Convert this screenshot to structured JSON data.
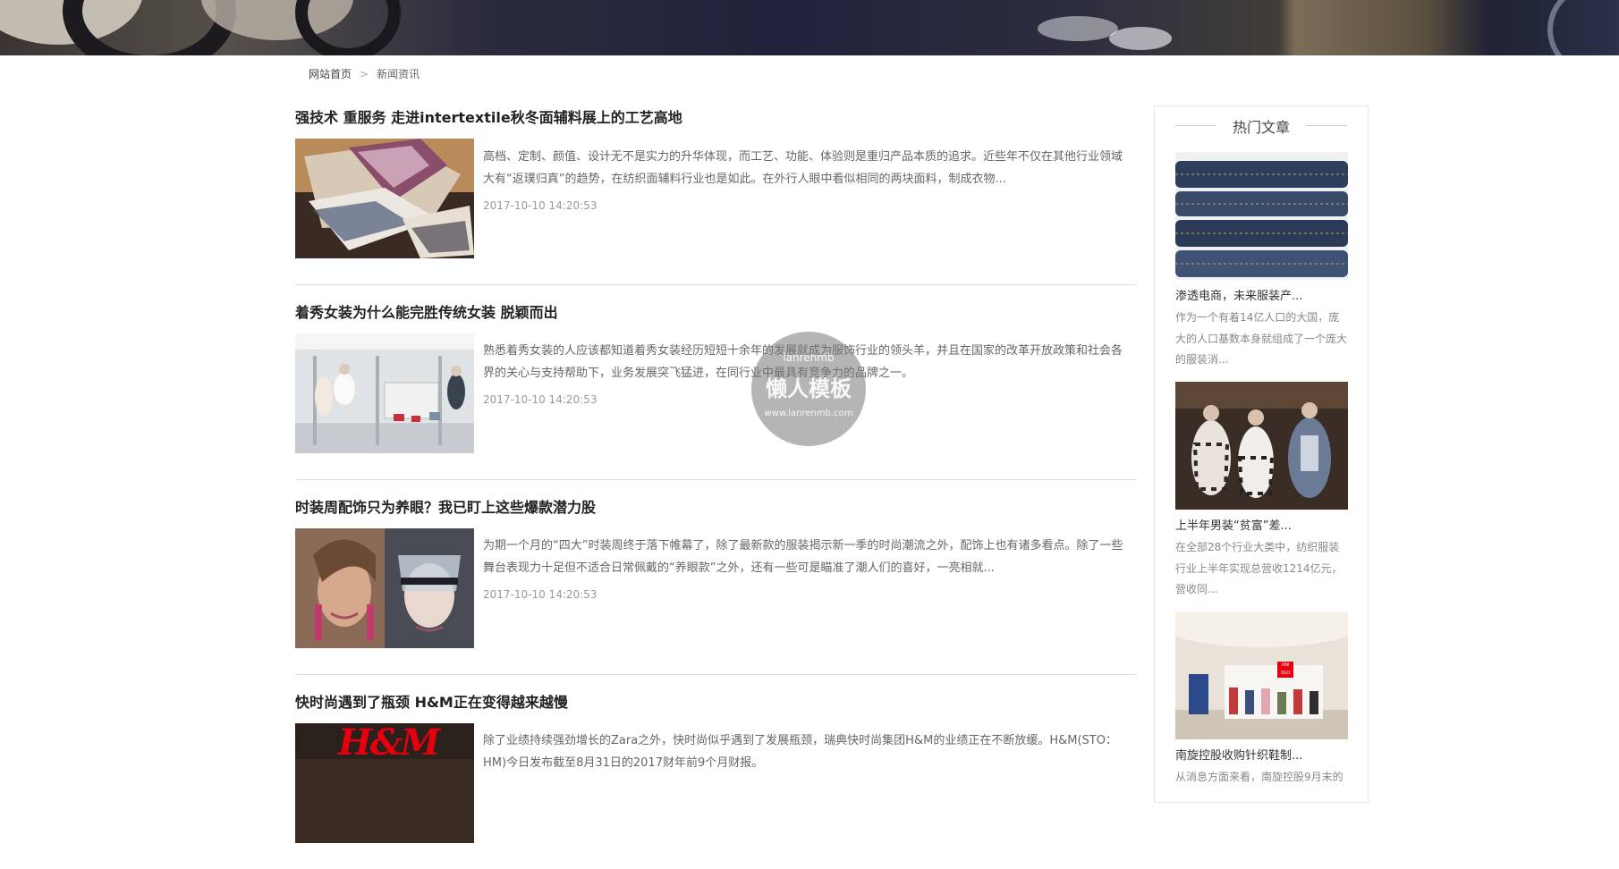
{
  "breadcrumb": {
    "home": "网站首页",
    "separator": ">",
    "current": "新闻资讯"
  },
  "articles": [
    {
      "title": "强技术 重服务 走进intertextile秋冬面辅料展上的工艺高地",
      "summary": "高档、定制、颜值、设计无不是实力的升华体现，而工艺、功能、体验则是重归产品本质的追求。近些年不仅在其他行业领域大有“返璞归真”的趋势，在纺织面辅料行业也是如此。在外行人眼中看似相同的两块面料，制成衣物...",
      "date": "2017-10-10 14:20:53",
      "image": "folded-textile-fabrics-photo"
    },
    {
      "title": "着秀女装为什么能完胜传统女装 脱颖而出",
      "summary": "熟悉着秀女装的人应该都知道着秀女装经历短短十余年的发展就成为服饰行业的领头羊，并且在国家的改革开放政策和社会各界的关心与支持帮助下，业务发展突飞猛进，在同行业中最具有竞争力的品牌之一。",
      "date": "2017-10-10 14:20:53",
      "image": "clothing-store-interior-photo"
    },
    {
      "title": "时装周配饰只为养眼？我已盯上这些爆款潜力股",
      "summary": "为期一个月的“四大”时装周终于落下帷幕了，除了最新款的服装揭示新一季的时尚潮流之外，配饰上也有诸多看点。除了一些舞台表现力十足但不适合日常佩戴的“养眼款”之外，还有一些可是瞄准了潮人们的喜好，一亮相就...",
      "date": "2017-10-10 14:20:53",
      "image": "fashion-models-accessories-photo"
    },
    {
      "title": "快时尚遇到了瓶颈 H&M正在变得越来越慢",
      "summary": "除了业绩持续强劲增长的Zara之外，快时尚似乎遇到了发展瓶颈，瑞典快时尚集团H&M的业绩正在不断放缓。H&M(STO：HM)今日发布截至8月31日的2017财年前9个月财报。",
      "date": "",
      "image": "hm-store-sign-photo",
      "logo_text": "H&M"
    }
  ],
  "sidebar": {
    "heading": "热门文章",
    "items": [
      {
        "title": "渗透电商，未来服装产...",
        "desc": "作为一个有着14亿人口的大国，庞大的人口基数本身就组成了一个庞大的服装消...",
        "image": "stacked-jeans-photo"
      },
      {
        "title": "上半年男装“贫富”差...",
        "desc": "在全部28个行业大类中，纺织服装行业上半年实现总营收1214亿元，营收同...",
        "image": "mannequins-store-photo"
      },
      {
        "title": "南旋控股收购针织鞋制...",
        "desc": "从消息方面来看，南旋控股9月末的",
        "image": "uniqlo-store-photo",
        "logo_text": "UNI QLO"
      }
    ]
  },
  "watermark": {
    "top": "lanrenmb",
    "main": "懒人模板",
    "url": "www.lanrenmb.com"
  },
  "colors": {
    "title": "#222222",
    "summary": "#666666",
    "date": "#999999",
    "divider": "#dcdcdc",
    "hm_red": "#e50010",
    "uniqlo_red": "#e60012"
  }
}
